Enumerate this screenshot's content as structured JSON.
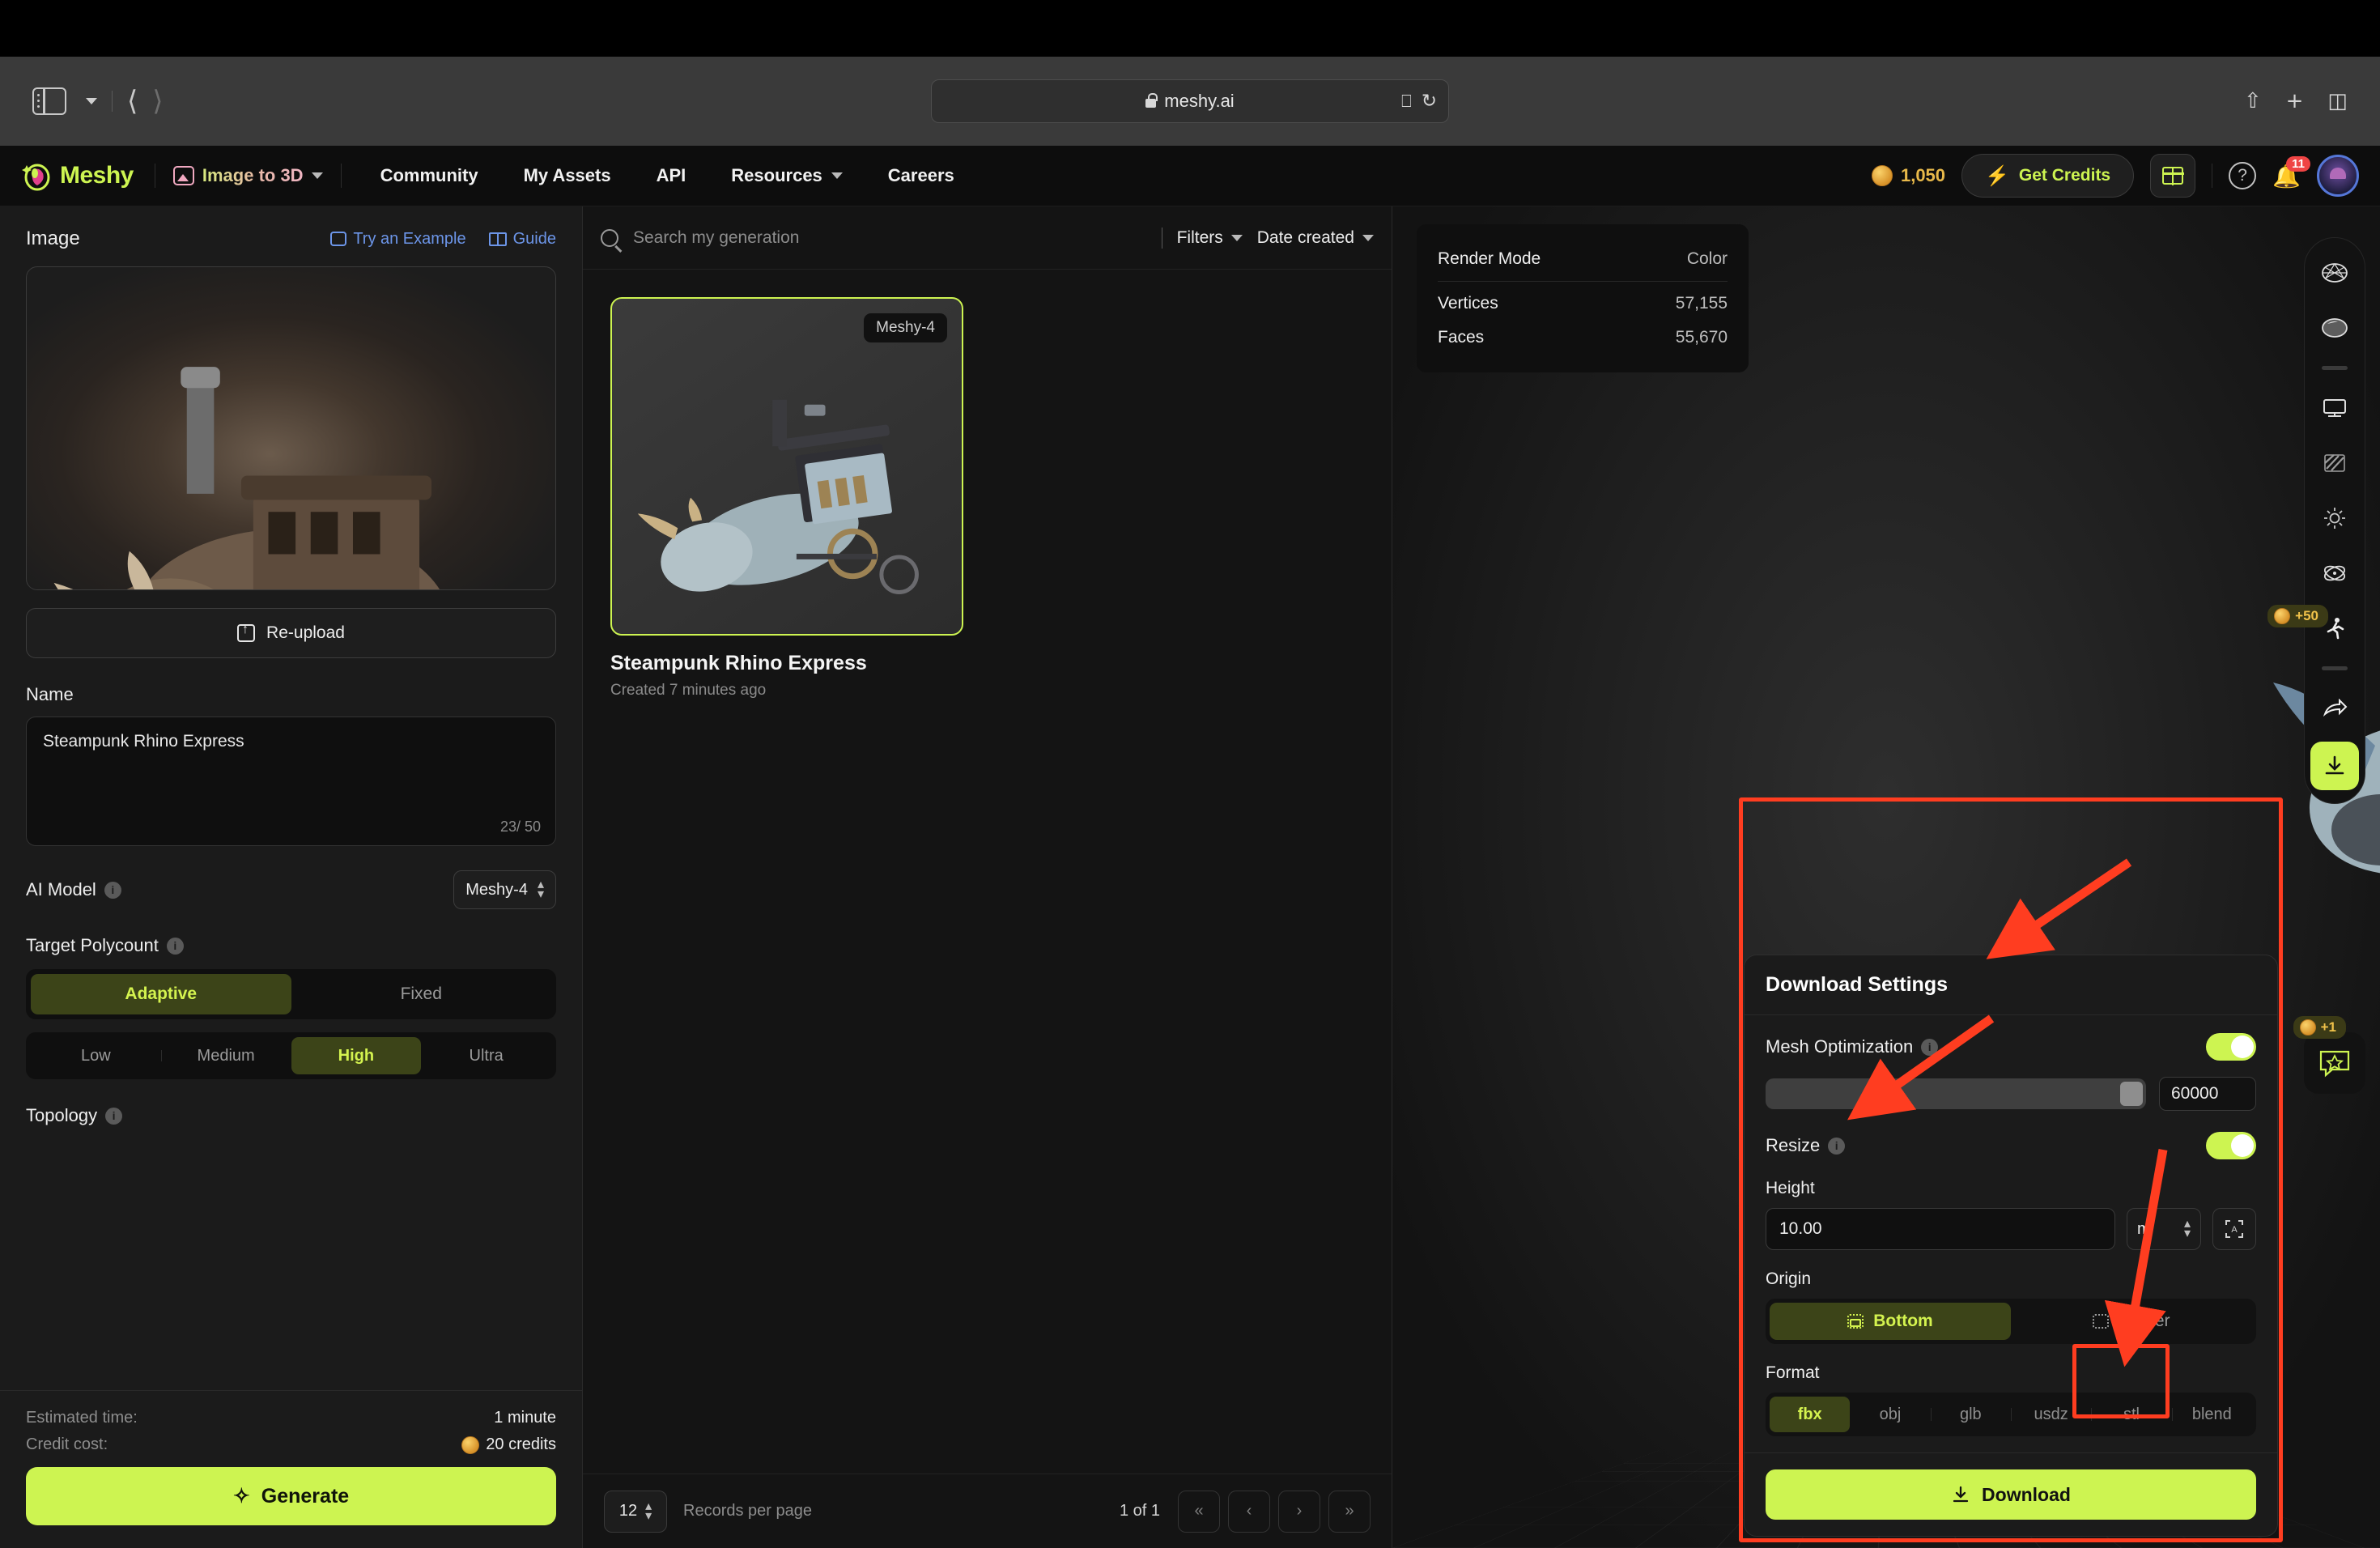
{
  "browser": {
    "url": "meshy.ai",
    "lock_icon": "lock-icon",
    "translate_icon": "translate-icon",
    "reload_icon": "reload-icon",
    "share_icon": "share-icon",
    "new_tab_icon": "plus-icon",
    "tabs_icon": "tabs-icon"
  },
  "topnav": {
    "brand": "Meshy",
    "mode": {
      "label": "Image to 3D",
      "icon": "image-icon"
    },
    "links": [
      "Community",
      "My Assets",
      "API",
      "Resources",
      "Careers"
    ],
    "credits_value": "1,050",
    "get_credits_label": "Get Credits",
    "notification_count": "11"
  },
  "left_panel": {
    "image_section_title": "Image",
    "try_example_label": "Try an Example",
    "guide_label": "Guide",
    "reupload_label": "Re-upload",
    "name_label": "Name",
    "name_value": "Steampunk Rhino Express",
    "char_count": "23/ 50",
    "ai_model_label": "AI Model",
    "ai_model_value": "Meshy-4",
    "target_polycount_label": "Target Polycount",
    "polycount_modes": [
      "Adaptive",
      "Fixed"
    ],
    "polycount_mode_active": "Adaptive",
    "polycount_levels": [
      "Low",
      "Medium",
      "High",
      "Ultra"
    ],
    "polycount_level_active": "High",
    "topology_label": "Topology",
    "estimated_time_key": "Estimated time:",
    "estimated_time_value": "1 minute",
    "credit_cost_key": "Credit cost:",
    "credit_cost_value": "20 credits",
    "generate_label": "Generate"
  },
  "middle_panel": {
    "search_placeholder": "Search my generation",
    "filters_label": "Filters",
    "sort_label": "Date created",
    "card": {
      "badge": "Meshy-4",
      "title": "Steampunk Rhino Express",
      "subtitle": "Created 7 minutes ago"
    },
    "records_per_page_value": "12",
    "records_per_page_label": "Records per page",
    "page_info": "1 of 1",
    "first_page_icon": "«",
    "prev_page_icon": "‹",
    "next_page_icon": "›",
    "last_page_icon": "»"
  },
  "viewport": {
    "stats": [
      {
        "key": "Render Mode",
        "value": "Color"
      },
      {
        "key": "Vertices",
        "value": "57,155"
      },
      {
        "key": "Faces",
        "value": "55,670"
      }
    ],
    "rail": [
      "wireframe-sphere-icon",
      "shaded-sphere-icon",
      "display-icon",
      "texture-icon",
      "lighting-icon",
      "physics-icon",
      "animate-icon",
      "share-icon",
      "download-icon"
    ],
    "share_bonus_badge": "+50",
    "feedback_bonus_badge": "+1"
  },
  "download_settings": {
    "title": "Download Settings",
    "mesh_optimization_label": "Mesh Optimization",
    "mesh_optimization_on": true,
    "polycount_value": "60000",
    "resize_label": "Resize",
    "resize_on": true,
    "height_label": "Height",
    "height_value": "10.00",
    "unit_value": "m",
    "origin_label": "Origin",
    "origin_options": [
      "Bottom",
      "Center"
    ],
    "origin_active": "Bottom",
    "format_label": "Format",
    "format_options": [
      "fbx",
      "obj",
      "glb",
      "usdz",
      "stl",
      "blend"
    ],
    "format_active": "fbx",
    "format_highlighted": "stl",
    "download_label": "Download"
  },
  "colors": {
    "accent_lime": "#cdf451",
    "annotation_red": "#ff3d20",
    "link_blue": "#6c95e8",
    "gold": "#e8b94a"
  }
}
